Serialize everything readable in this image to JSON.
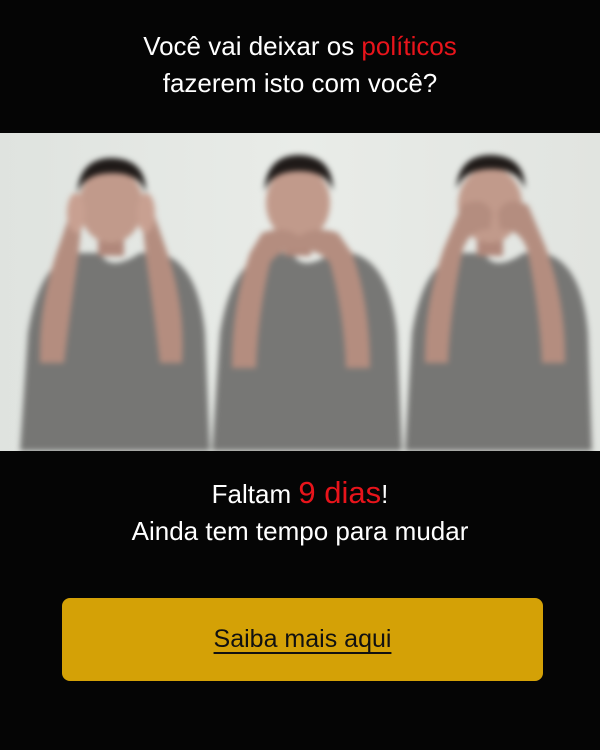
{
  "headline": {
    "line1_prefix": "Você vai deixar os ",
    "line1_highlight": "políticos",
    "line2": "fazerem isto com você?"
  },
  "image": {
    "subject": "three-figures-see-hear-speak-no-evil"
  },
  "countdown": {
    "prefix": "Faltam ",
    "highlight": "9 dias",
    "suffix": "!",
    "line2": "Ainda tem tempo para mudar"
  },
  "cta": {
    "label": "Saiba mais aqui"
  },
  "colors": {
    "background": "#050505",
    "highlight": "#e8141b",
    "button": "#d4a106"
  }
}
